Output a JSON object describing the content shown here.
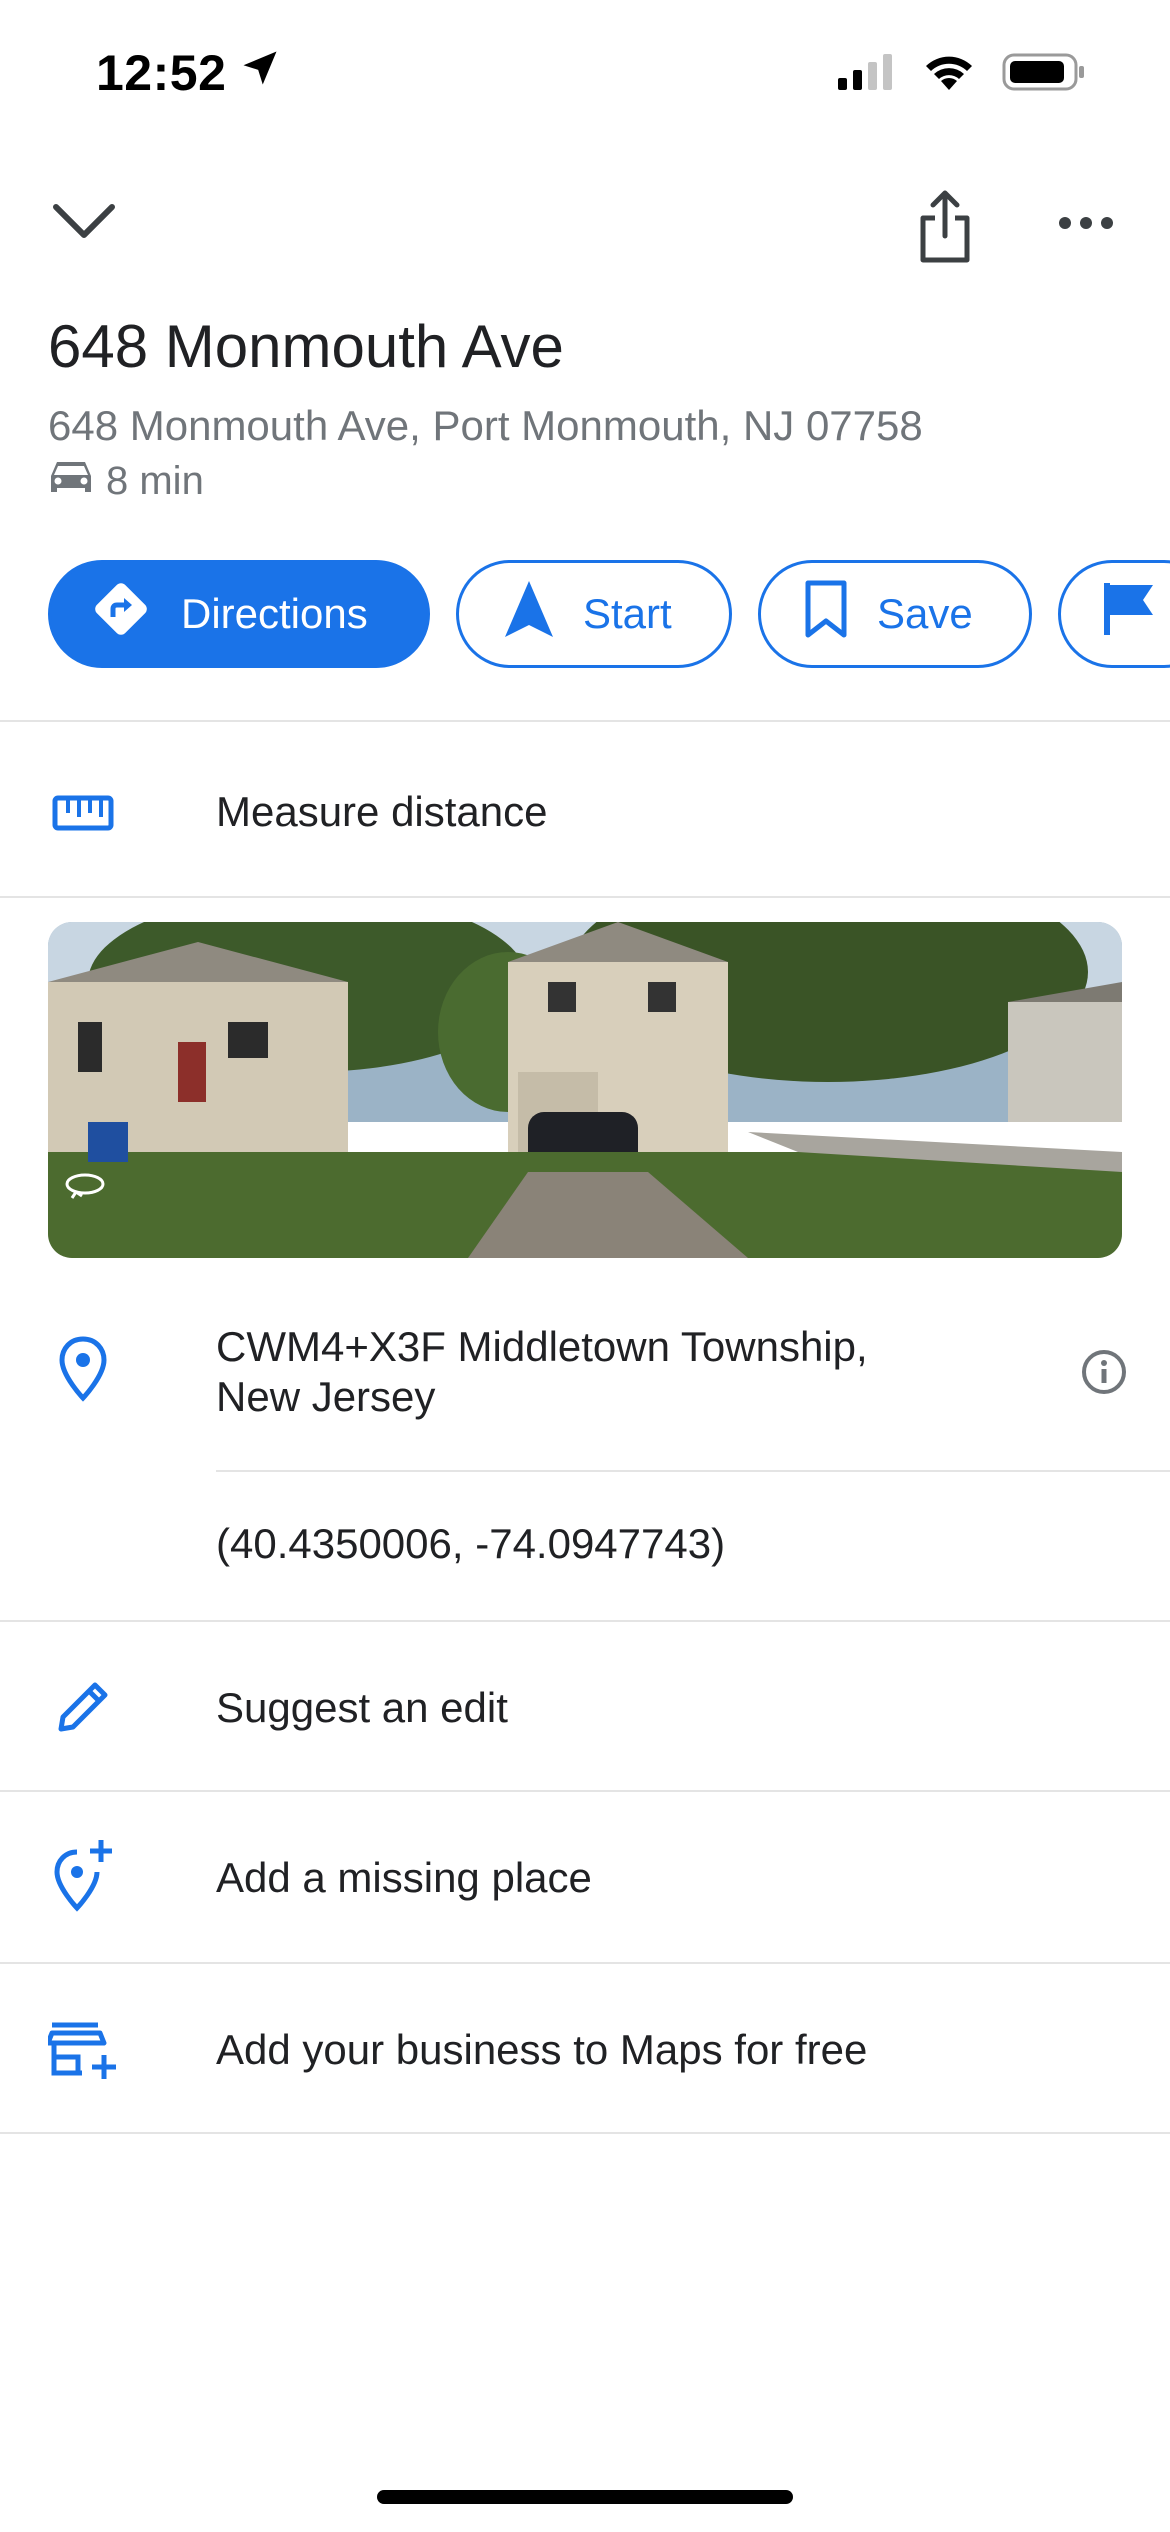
{
  "status_bar": {
    "time": "12:52"
  },
  "toolbar": {},
  "place": {
    "title": "648 Monmouth Ave",
    "address": "648 Monmouth Ave, Port Monmouth, NJ 07758",
    "drive_time": "8 min"
  },
  "actions": {
    "directions": "Directions",
    "start": "Start",
    "save": "Save"
  },
  "rows": {
    "measure_distance": "Measure distance",
    "plus_code": "CWM4+X3F Middletown Township,",
    "plus_code_line2": "New Jersey",
    "coordinates": "(40.4350006, -74.0947743)",
    "suggest_edit": "Suggest an edit",
    "add_missing_place": "Add a missing place",
    "add_business": "Add your business to Maps for free"
  },
  "colors": {
    "accent": "#1a73e8",
    "secondary_text": "#70757a",
    "divider": "#e4e4e4"
  }
}
